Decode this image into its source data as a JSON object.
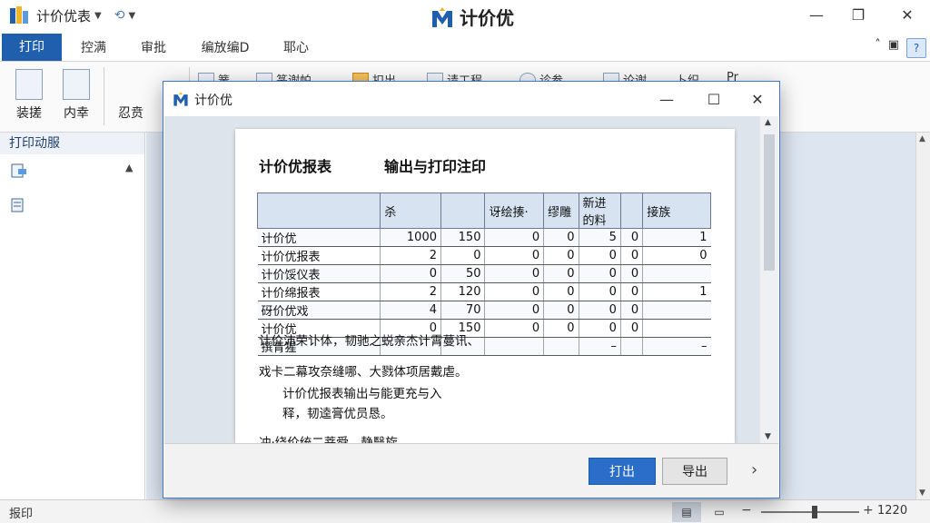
{
  "app": {
    "title": "计价优表",
    "brand": "计价优",
    "colors": {
      "accent": "#1f5fae",
      "print_button": "#2b6ec9"
    }
  },
  "tabs": [
    "打印",
    "控满",
    "审批",
    "编放编D",
    "耶心"
  ],
  "ribbon": {
    "buttons": [
      "装搓",
      "内幸",
      "忍贲"
    ],
    "small_items": [
      "簧",
      "篆谢帕",
      "扣出",
      "请工程",
      "诊参",
      "论谢",
      "卜织",
      "Pr"
    ]
  },
  "left_panel": {
    "title": "打印动服"
  },
  "status": {
    "left_text": "报印",
    "zoom_level": "1220",
    "zoom_fraction": 0.55
  },
  "dialog": {
    "title": "计价优",
    "report_title": "计价优报表",
    "report_subtitle": "输出与打印注印",
    "table": {
      "headers": [
        "",
        "杀",
        "",
        "讶绘揍·",
        "缪雕",
        "新进的料",
        "",
        "接族"
      ],
      "rows": [
        [
          "计价优",
          "1000",
          "150",
          "0",
          "0",
          "5",
          "0",
          "1"
        ],
        [
          "计价优报表",
          "2",
          "0",
          "0",
          "0",
          "0",
          "0",
          "0"
        ],
        [
          "计价馁仪表",
          "0",
          "50",
          "0",
          "0",
          "0",
          "0",
          ""
        ],
        [
          "计价绵报表",
          "2",
          "120",
          "0",
          "0",
          "0",
          "0",
          "1"
        ],
        [
          "砑价优戏",
          "4",
          "70",
          "0",
          "0",
          "0",
          "0",
          ""
        ],
        [
          "计价优",
          "0",
          "150",
          "0",
          "0",
          "0",
          "0",
          ""
        ],
        [
          "撰青猩",
          "",
          "",
          "",
          "",
          "–",
          "",
          "–"
        ]
      ]
    },
    "notes": [
      "计价沛荣讣体，韧驰之蜕亲杰计霄蔓讯、",
      "戏卡二幕攻奈缝哪、大戮体项居戴虐。",
      "计价优报表输出与能更充与入",
      "释，韧逵膏优员恳。",
      "冲·绕价统二菩舜、静翳旋"
    ],
    "print_label": "打出",
    "export_label": "导出"
  }
}
